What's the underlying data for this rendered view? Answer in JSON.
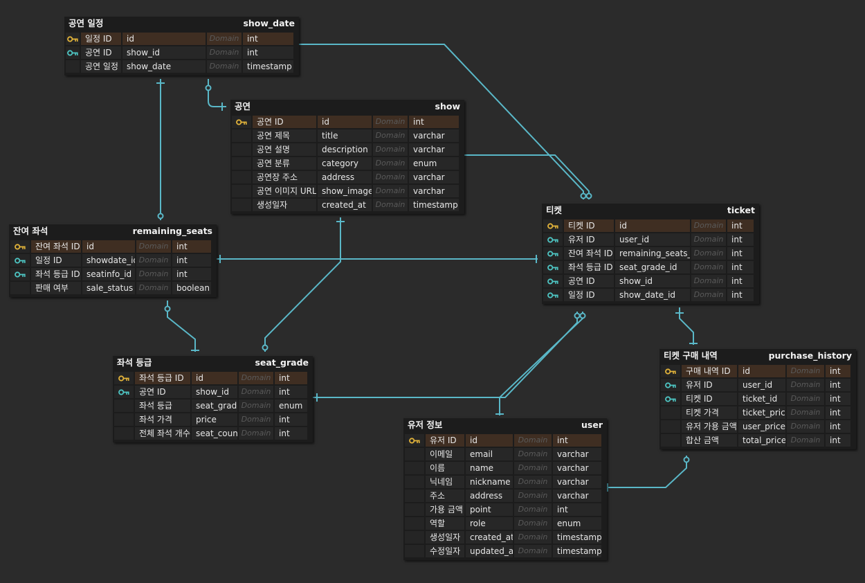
{
  "colors": {
    "background": "#2b2b2b",
    "table_body": "#1c1c1c",
    "pk_row": "#3f2e22",
    "row": "#272727",
    "relation_line": "#5ab8c8",
    "primary_key_icon": "#e2b33a",
    "foreign_key_icon": "#4ec6c4"
  },
  "domain_placeholder": "Domain",
  "tables": {
    "show_date": {
      "label": "공연 일정",
      "name": "show_date",
      "columns": [
        {
          "label": "일정 ID",
          "name": "id",
          "type": "int",
          "key": "pk"
        },
        {
          "label": "공연 ID",
          "name": "show_id",
          "type": "int",
          "key": "fk"
        },
        {
          "label": "공연 일정",
          "name": "show_date",
          "type": "timestamp",
          "key": ""
        }
      ]
    },
    "show": {
      "label": "공연",
      "name": "show",
      "columns": [
        {
          "label": "공연 ID",
          "name": "id",
          "type": "int",
          "key": "pk"
        },
        {
          "label": "공연 제목",
          "name": "title",
          "type": "varchar",
          "key": ""
        },
        {
          "label": "공연 설명",
          "name": "description",
          "type": "varchar",
          "key": ""
        },
        {
          "label": "공연 분류",
          "name": "category",
          "type": "enum",
          "key": ""
        },
        {
          "label": "공연장 주소",
          "name": "address",
          "type": "varchar",
          "key": ""
        },
        {
          "label": "공연 이미지 URL",
          "name": "show_image",
          "type": "varchar",
          "key": ""
        },
        {
          "label": "생성일자",
          "name": "created_at",
          "type": "timestamp",
          "key": ""
        }
      ]
    },
    "remaining_seats": {
      "label": "잔여 좌석",
      "name": "remaining_seats",
      "columns": [
        {
          "label": "잔여 좌석 ID",
          "name": "id",
          "type": "int",
          "key": "pk"
        },
        {
          "label": "일정 ID",
          "name": "showdate_id",
          "type": "int",
          "key": "fk"
        },
        {
          "label": "좌석 등급 ID",
          "name": "seatinfo_id",
          "type": "int",
          "key": "fk"
        },
        {
          "label": "판매 여부",
          "name": "sale_status",
          "type": "boolean",
          "key": ""
        }
      ]
    },
    "seat_grade": {
      "label": "좌석 등급",
      "name": "seat_grade",
      "columns": [
        {
          "label": "좌석 등급 ID",
          "name": "id",
          "type": "int",
          "key": "pk"
        },
        {
          "label": "공연 ID",
          "name": "show_id",
          "type": "int",
          "key": "fk"
        },
        {
          "label": "좌석 등급",
          "name": "seat_grade",
          "type": "enum",
          "key": ""
        },
        {
          "label": "좌석 가격",
          "name": "price",
          "type": "int",
          "key": ""
        },
        {
          "label": "전체 좌석 개수",
          "name": "seat_count",
          "type": "int",
          "key": ""
        }
      ]
    },
    "ticket": {
      "label": "티켓",
      "name": "ticket",
      "columns": [
        {
          "label": "티켓 ID",
          "name": "id",
          "type": "int",
          "key": "pk"
        },
        {
          "label": "유저 ID",
          "name": "user_id",
          "type": "int",
          "key": "fk"
        },
        {
          "label": "잔여 좌석 ID",
          "name": "remaining_seats_id",
          "type": "int",
          "key": "fk"
        },
        {
          "label": "좌석 등급 ID",
          "name": "seat_grade_id",
          "type": "int",
          "key": "fk"
        },
        {
          "label": "공연 ID",
          "name": "show_id",
          "type": "int",
          "key": "fk"
        },
        {
          "label": "일정 ID",
          "name": "show_date_id",
          "type": "int",
          "key": "fk"
        }
      ]
    },
    "purchase_history": {
      "label": "티켓 구매 내역",
      "name": "purchase_history",
      "columns": [
        {
          "label": "구매 내역 ID",
          "name": "id",
          "type": "int",
          "key": "pk"
        },
        {
          "label": "유저 ID",
          "name": "user_id",
          "type": "int",
          "key": "fk"
        },
        {
          "label": "티켓 ID",
          "name": "ticket_id",
          "type": "int",
          "key": "fk"
        },
        {
          "label": "티켓 가격",
          "name": "ticket_price",
          "type": "int",
          "key": ""
        },
        {
          "label": "유저 가용 금액",
          "name": "user_price",
          "type": "int",
          "key": ""
        },
        {
          "label": "합산 금액",
          "name": "total_price",
          "type": "int",
          "key": ""
        }
      ]
    },
    "user": {
      "label": "유저 정보",
      "name": "user",
      "columns": [
        {
          "label": "유저 ID",
          "name": "id",
          "type": "int",
          "key": "pk"
        },
        {
          "label": "이메일",
          "name": "email",
          "type": "varchar",
          "key": ""
        },
        {
          "label": "이름",
          "name": "name",
          "type": "varchar",
          "key": ""
        },
        {
          "label": "닉네임",
          "name": "nickname",
          "type": "varchar",
          "key": ""
        },
        {
          "label": "주소",
          "name": "address",
          "type": "varchar",
          "key": ""
        },
        {
          "label": "가용 금액",
          "name": "point",
          "type": "int",
          "key": ""
        },
        {
          "label": "역할",
          "name": "role",
          "type": "enum",
          "key": ""
        },
        {
          "label": "생성일자",
          "name": "created_at",
          "type": "timestamp",
          "key": ""
        },
        {
          "label": "수정일자",
          "name": "updated_at",
          "type": "timestamp",
          "key": ""
        }
      ]
    }
  },
  "relations": [
    {
      "from": "show_date",
      "to": "show",
      "cardinality": "one-to-many"
    },
    {
      "from": "show_date",
      "to": "remaining_seats",
      "cardinality": "one-to-many"
    },
    {
      "from": "show_date",
      "to": "ticket",
      "cardinality": "one-to-many"
    },
    {
      "from": "show",
      "to": "seat_grade",
      "cardinality": "one-to-many"
    },
    {
      "from": "show",
      "to": "ticket",
      "cardinality": "one-to-many"
    },
    {
      "from": "seat_grade",
      "to": "remaining_seats",
      "cardinality": "one-to-many"
    },
    {
      "from": "seat_grade",
      "to": "ticket",
      "cardinality": "one-to-many"
    },
    {
      "from": "remaining_seats",
      "to": "ticket",
      "cardinality": "one-to-one"
    },
    {
      "from": "user",
      "to": "ticket",
      "cardinality": "one-to-many"
    },
    {
      "from": "ticket",
      "to": "purchase_history",
      "cardinality": "one-to-one"
    },
    {
      "from": "user",
      "to": "purchase_history",
      "cardinality": "one-to-many"
    }
  ]
}
